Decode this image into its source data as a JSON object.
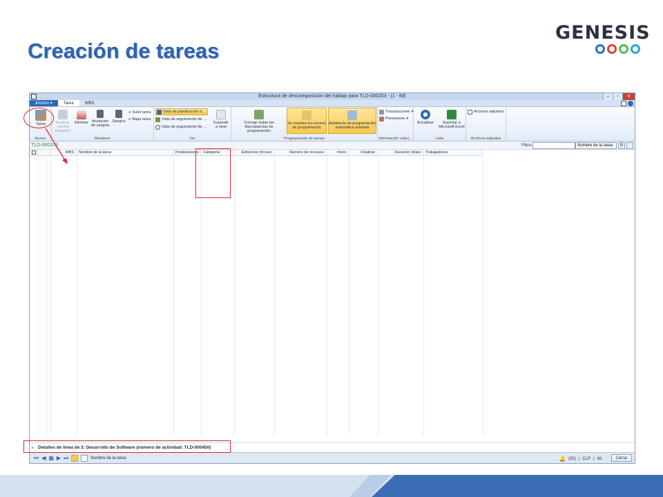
{
  "slide": {
    "title": "Creación de tareas"
  },
  "logo": {
    "text": "GENESIS",
    "ring_colors": [
      "#2b6fb6",
      "#e23c3c",
      "#5bb74d",
      "#27a6d9"
    ]
  },
  "window": {
    "title": "Estructura de descomposición del trabajo para TLD-000203 - (1 - tld)",
    "controls": {
      "minimize": "–",
      "restore": "▫",
      "close": "x"
    }
  },
  "tabs": {
    "file": "Archivo",
    "file_caret": "▾",
    "task": "Tarea",
    "wbs": "WBS"
  },
  "ribbon": {
    "nuevo": {
      "task": "Tarea",
      "label": "Nuevo"
    },
    "mantener": {
      "complete": "Realizar control completo",
      "delete": "Eliminar",
      "outdent": "Anulación de sangría",
      "indent": "Sangría",
      "move_up": "Subir tarea",
      "move_down": "Bajar tarea",
      "label": "Mantener"
    },
    "ver": {
      "planning_view": "Vista de planificación d...",
      "tracking_view_1": "Vista de seguimiento de ...",
      "tracking_view_2": "Vista de seguimiento de ...",
      "expand": "Expandir a nivel",
      "label": "Ver"
    },
    "programacion": {
      "fix_all": "Corregir todas las discrepancias de programación",
      "show_errors": "Se muestra los errores de programación",
      "assist": "Asistencia de programación automática activada",
      "label": "Programación de tareas"
    },
    "info": {
      "transactions": "Transacciones",
      "forecasts": "Previsiones",
      "label": "Información relaci..."
    },
    "lista": {
      "refresh": "Actualizar",
      "export": "Exportar a Microsoft Excel",
      "label": "Lista"
    },
    "adjuntos": {
      "attachments": "Archivos adjuntos",
      "label": "Archivos adjuntos"
    }
  },
  "subheader": {
    "breadcrumb": "TLD-000203",
    "filter_label": "Filtro:",
    "filter_value": "",
    "filter_field": "Nombre de la tarea"
  },
  "grid": {
    "columns": [
      "WBS",
      "Nombre de la tarea",
      "Predecesores",
      "Categoría",
      "Esfuerzos (horas)",
      "Número de recursos",
      "Inicio",
      "Finalizar",
      "Duración (días)",
      "Trabajadores"
    ]
  },
  "details": {
    "text": "Detalles de línea de 3: Desarrollo de Software (número de actividad: TLD-000450)"
  },
  "status": {
    "field": "Nombre de la tarea",
    "notifications": "(32)",
    "currency": "CLP",
    "company": "tld",
    "close": "Cerrar"
  },
  "colors": {
    "title": "#2e63b3",
    "annotation": "#e0252b",
    "highlight": "#f9c851"
  }
}
